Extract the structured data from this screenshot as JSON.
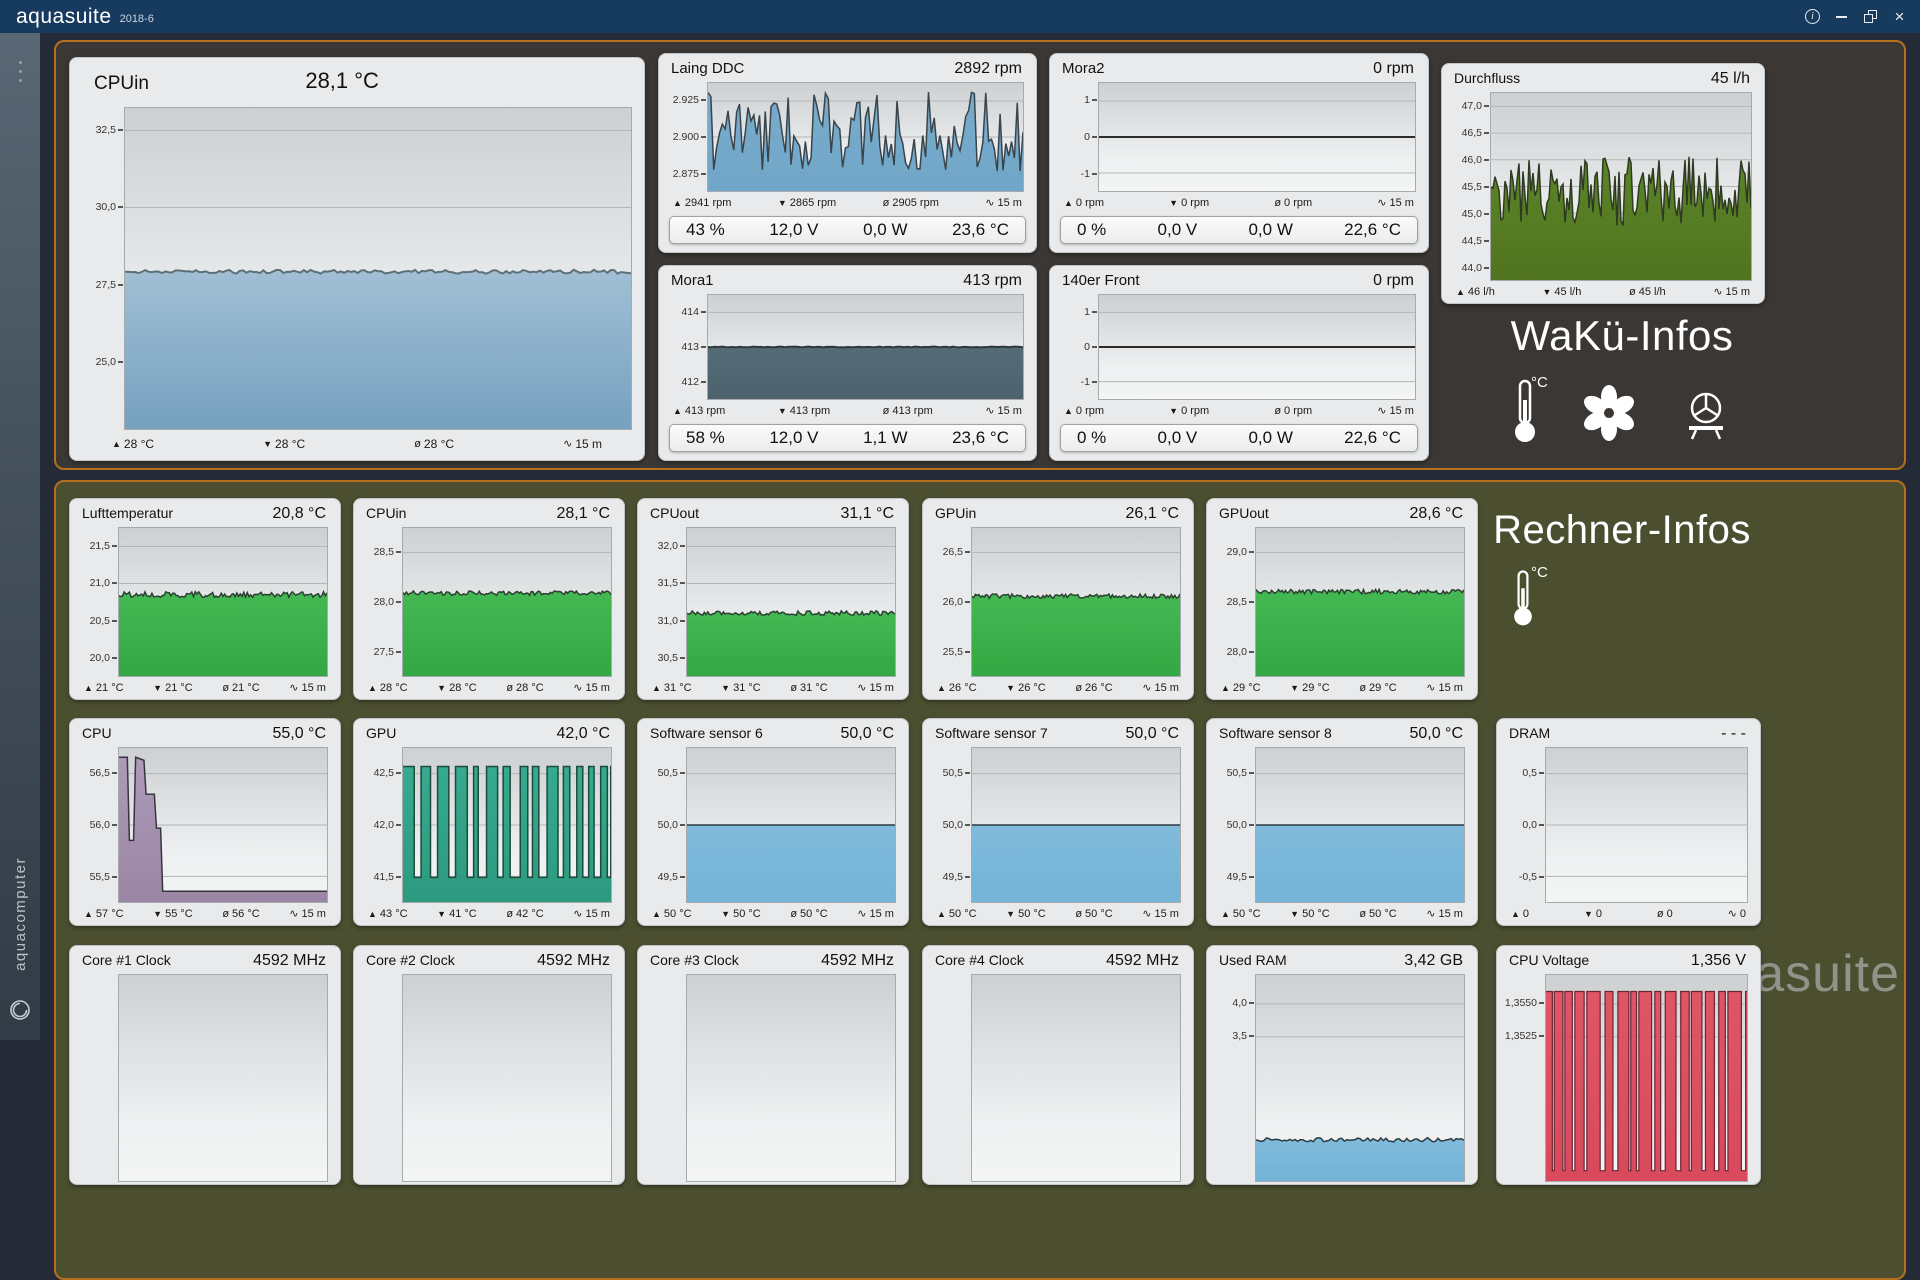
{
  "titlebar": {
    "app": "aquasuite",
    "version": "2018-6",
    "icons": {
      "info": "i",
      "close": "×"
    }
  },
  "sidebar": {
    "brand": "aquacomputer"
  },
  "watermark": "aquasuite",
  "ui": {
    "icons": {
      "max": "▲",
      "min": "▼",
      "avg": "ø",
      "time": "∿"
    }
  },
  "sections": {
    "waku": {
      "title": "WaKü-Infos",
      "unit_label": "°C",
      "panels": {
        "cpuin_big": {
          "name": "CPUin",
          "value": "28,1 °C",
          "chart": {
            "ticks": [
              "32,5",
              "30,0",
              "27,5",
              "25,0"
            ],
            "tick_fracs": [
              0.07,
              0.31,
              0.55,
              0.79
            ],
            "pattern": "flat",
            "level": 0.51,
            "amp": 0.006,
            "seed": 11,
            "n": 150,
            "fill": [
              "#9dbdd4",
              "#6f9cbc"
            ],
            "stroke": "#5d7078",
            "sw": 2
          },
          "footer": {
            "max": "28 °C",
            "min": "28 °C",
            "avg": "28 °C",
            "time": "15 m"
          }
        },
        "laing": {
          "name": "Laing DDC",
          "value": "2892 rpm",
          "chart": {
            "ticks": [
              "2.925",
              "2.900",
              "2.875"
            ],
            "pattern": "noise",
            "lo": 0.08,
            "hi": 0.82,
            "seed": 7,
            "n": 110,
            "fill": [
              "#74a9ca",
              "#6aa2c6"
            ],
            "stroke": "#39444b",
            "sw": 1.5
          },
          "footer": {
            "max": "2941 rpm",
            "min": "2865 rpm",
            "avg": "2905 rpm",
            "time": "15 m"
          },
          "stats": [
            "43 %",
            "12,0 V",
            "0,0 W",
            "23,6 °C"
          ]
        },
        "mora2": {
          "name": "Mora2",
          "value": "0 rpm",
          "chart": {
            "ticks": [
              "1",
              "0",
              "-1"
            ],
            "pattern": "flat",
            "level": 0.5,
            "amp": 0,
            "seed": 2,
            "n": 4,
            "no_fill": true,
            "stroke": "#2c2c2c",
            "sw": 2
          },
          "footer": {
            "max": "0 rpm",
            "min": "0 rpm",
            "avg": "0 rpm",
            "time": "15 m"
          },
          "stats": [
            "0 %",
            "0,0 V",
            "0,0 W",
            "22,6 °C"
          ]
        },
        "durchfluss": {
          "name": "Durchfluss",
          "value": "45 l/h",
          "chart": {
            "ticks": [
              "47,0",
              "46,5",
              "46,0",
              "45,5",
              "45,0",
              "44,5",
              "44,0"
            ],
            "pattern": "noise",
            "lo": 0.34,
            "hi": 0.72,
            "seed": 21,
            "n": 130,
            "fill": [
              "#55801e",
              "#486d14"
            ],
            "stroke": "#2e3a22",
            "sw": 1.5
          },
          "footer": {
            "max": "46 l/h",
            "min": "45 l/h",
            "avg": "45 l/h",
            "time": "15 m"
          }
        },
        "mora1": {
          "name": "Mora1",
          "value": "413 rpm",
          "chart": {
            "ticks": [
              "414",
              "413",
              "412"
            ],
            "pattern": "flat",
            "level": 0.5,
            "amp": 0.004,
            "seed": 5,
            "n": 90,
            "fill": [
              "#4d6570",
              "#445a65"
            ],
            "stroke": "#2c3940",
            "sw": 2
          },
          "footer": {
            "max": "413 rpm",
            "min": "413 rpm",
            "avg": "413 rpm",
            "time": "15 m"
          },
          "stats": [
            "58 %",
            "12,0 V",
            "1,1 W",
            "23,6 °C"
          ]
        },
        "front140": {
          "name": "140er Front",
          "value": "0 rpm",
          "chart": {
            "ticks": [
              "1",
              "0",
              "-1"
            ],
            "pattern": "flat",
            "level": 0.5,
            "amp": 0,
            "seed": 3,
            "n": 4,
            "no_fill": true,
            "stroke": "#2c2c2c",
            "sw": 2
          },
          "footer": {
            "max": "0 rpm",
            "min": "0 rpm",
            "avg": "0 rpm",
            "time": "15 m"
          },
          "stats": [
            "0 %",
            "0,0 V",
            "0,0 W",
            "22,6 °C"
          ]
        }
      }
    },
    "rechner": {
      "title": "Rechner-Infos",
      "unit_label": "°C",
      "panels": {
        "luft": {
          "name": "Lufttemperatur",
          "value": "20,8 °C",
          "chart": {
            "ticks": [
              "21,5",
              "21,0",
              "20,5",
              "20,0"
            ],
            "pattern": "flat",
            "level": 0.45,
            "amp": 0.02,
            "seed": 31,
            "n": 120,
            "fill": [
              "#3bb64b",
              "#2aa33a"
            ],
            "stroke": "#2c4030",
            "sw": 1.5
          },
          "footer": {
            "max": "21 °C",
            "min": "21 °C",
            "avg": "21 °C",
            "time": "15 m"
          }
        },
        "cpuin": {
          "name": "CPUin",
          "value": "28,1 °C",
          "chart": {
            "ticks": [
              "28,5",
              "28,0",
              "27,5"
            ],
            "pattern": "flat",
            "level": 0.44,
            "amp": 0.015,
            "seed": 32,
            "n": 120,
            "fill": [
              "#3bb64b",
              "#2aa33a"
            ],
            "stroke": "#2c4030",
            "sw": 1.5
          },
          "footer": {
            "max": "28 °C",
            "min": "28 °C",
            "avg": "28 °C",
            "time": "15 m"
          }
        },
        "cpuout": {
          "name": "CPUout",
          "value": "31,1 °C",
          "chart": {
            "ticks": [
              "32,0",
              "31,5",
              "31,0",
              "30,5"
            ],
            "pattern": "flat",
            "level": 0.575,
            "amp": 0.015,
            "seed": 33,
            "n": 120,
            "fill": [
              "#3bb64b",
              "#2aa33a"
            ],
            "stroke": "#2c4030",
            "sw": 1.5
          },
          "footer": {
            "max": "31 °C",
            "min": "31 °C",
            "avg": "31 °C",
            "time": "15 m"
          }
        },
        "gpuin": {
          "name": "GPUin",
          "value": "26,1 °C",
          "chart": {
            "ticks": [
              "26,5",
              "26,0",
              "25,5"
            ],
            "pattern": "flat",
            "level": 0.46,
            "amp": 0.015,
            "seed": 34,
            "n": 120,
            "fill": [
              "#3bb64b",
              "#2aa33a"
            ],
            "stroke": "#2c4030",
            "sw": 1.5
          },
          "footer": {
            "max": "26 °C",
            "min": "26 °C",
            "avg": "26 °C",
            "time": "15 m"
          }
        },
        "gpuout": {
          "name": "GPUout",
          "value": "28,6 °C",
          "chart": {
            "ticks": [
              "29,0",
              "28,5",
              "28,0"
            ],
            "pattern": "flat",
            "level": 0.43,
            "amp": 0.015,
            "seed": 35,
            "n": 120,
            "fill": [
              "#3bb64b",
              "#2aa33a"
            ],
            "stroke": "#2c4030",
            "sw": 1.5
          },
          "footer": {
            "max": "29 °C",
            "min": "29 °C",
            "avg": "29 °C",
            "time": "15 m"
          }
        },
        "cpu": {
          "name": "CPU",
          "value": "55,0 °C",
          "chart": {
            "ticks": [
              "56,5",
              "56,0",
              "55,5"
            ],
            "pattern": "points",
            "pts": [
              [
                0,
                0.06
              ],
              [
                4,
                0.06
              ],
              [
                5,
                0.6
              ],
              [
                7,
                0.6
              ],
              [
                8,
                0.06
              ],
              [
                12,
                0.08
              ],
              [
                13,
                0.3
              ],
              [
                17,
                0.3
              ],
              [
                18,
                0.52
              ],
              [
                20,
                0.52
              ],
              [
                21,
                0.93
              ],
              [
                100,
                0.93
              ]
            ],
            "fill": [
              "#ab97b8",
              "#95809f"
            ],
            "stroke": "#3a3340",
            "sw": 1.5
          },
          "footer": {
            "max": "57 °C",
            "min": "55 °C",
            "avg": "56 °C",
            "time": "15 m"
          }
        },
        "gpu": {
          "name": "GPU",
          "value": "42,0 °C",
          "chart": {
            "ticks": [
              "42,5",
              "42,0",
              "41,5"
            ],
            "pattern": "square",
            "hi": 0.12,
            "lo": 0.84,
            "hi_w": [
              2,
              6
            ],
            "lo_w": [
              1.5,
              5
            ],
            "seed": 41,
            "fill": [
              "#2da88a",
              "#239579"
            ],
            "stroke": "#1d4a3c",
            "sw": 1.5
          },
          "footer": {
            "max": "43 °C",
            "min": "41 °C",
            "avg": "42 °C",
            "time": "15 m"
          }
        },
        "sw6": {
          "name": "Software sensor 6",
          "value": "50,0 °C",
          "chart": {
            "ticks": [
              "50,5",
              "50,0",
              "49,5"
            ],
            "pattern": "flat",
            "level": 0.5,
            "amp": 0,
            "seed": 1,
            "n": 4,
            "fill": [
              "#7bb8da",
              "#6db0d5"
            ],
            "stroke": "#2c3a42",
            "sw": 1.5
          },
          "footer": {
            "max": "50 °C",
            "min": "50 °C",
            "avg": "50 °C",
            "time": "15 m"
          }
        },
        "sw7": {
          "name": "Software sensor 7",
          "value": "50,0 °C",
          "chart": {
            "ticks": [
              "50,5",
              "50,0",
              "49,5"
            ],
            "pattern": "flat",
            "level": 0.5,
            "amp": 0,
            "seed": 1,
            "n": 4,
            "fill": [
              "#7bb8da",
              "#6db0d5"
            ],
            "stroke": "#2c3a42",
            "sw": 1.5
          },
          "footer": {
            "max": "50 °C",
            "min": "50 °C",
            "avg": "50 °C",
            "time": "15 m"
          }
        },
        "sw8": {
          "name": "Software sensor 8",
          "value": "50,0 °C",
          "chart": {
            "ticks": [
              "50,5",
              "50,0",
              "49,5"
            ],
            "pattern": "flat",
            "level": 0.5,
            "amp": 0,
            "seed": 1,
            "n": 4,
            "fill": [
              "#7bb8da",
              "#6db0d5"
            ],
            "stroke": "#2c3a42",
            "sw": 1.5
          },
          "footer": {
            "max": "50 °C",
            "min": "50 °C",
            "avg": "50 °C",
            "time": "15 m"
          }
        },
        "dram": {
          "name": "DRAM",
          "value": "- - -",
          "chart": {
            "ticks": [
              "0,5",
              "0,0",
              "-0,5"
            ],
            "pattern": "none"
          },
          "footer": {
            "max": "0",
            "min": "0",
            "avg": "0",
            "time": "0"
          }
        },
        "core1": {
          "name": "Core #1 Clock",
          "value": "4592 MHz",
          "chart": {
            "ticks": [],
            "pattern": "none"
          }
        },
        "core2": {
          "name": "Core #2 Clock",
          "value": "4592 MHz",
          "chart": {
            "ticks": [],
            "pattern": "none"
          }
        },
        "core3": {
          "name": "Core #3 Clock",
          "value": "4592 MHz",
          "chart": {
            "ticks": [],
            "pattern": "none"
          }
        },
        "core4": {
          "name": "Core #4 Clock",
          "value": "4592 MHz",
          "chart": {
            "ticks": [],
            "pattern": "none"
          }
        },
        "used_ram": {
          "name": "Used RAM",
          "value": "3,42 GB",
          "chart": {
            "ticks": [
              "4,0",
              "3,5"
            ],
            "tick_fracs": [
              0.14,
              0.3
            ],
            "pattern": "flat",
            "level": 0.8,
            "amp": 0.01,
            "seed": 61,
            "n": 80,
            "fill": [
              "#7bb8da",
              "#6db0d5"
            ],
            "stroke": "#2c3a42",
            "sw": 1.5
          }
        },
        "voltage": {
          "name": "CPU Voltage",
          "value": "1,356 V",
          "chart": {
            "ticks": [
              "1,3550",
              "1,3525"
            ],
            "tick_fracs": [
              0.14,
              0.3
            ],
            "pattern": "square",
            "hi": 0.08,
            "lo": 0.95,
            "hi_w": [
              2.5,
              7
            ],
            "lo_w": [
              0.8,
              2.5
            ],
            "seed": 51,
            "fill": [
              "#e14f60",
              "#d64053"
            ],
            "stroke": "#6b2430",
            "sw": 1.2
          }
        }
      }
    }
  }
}
